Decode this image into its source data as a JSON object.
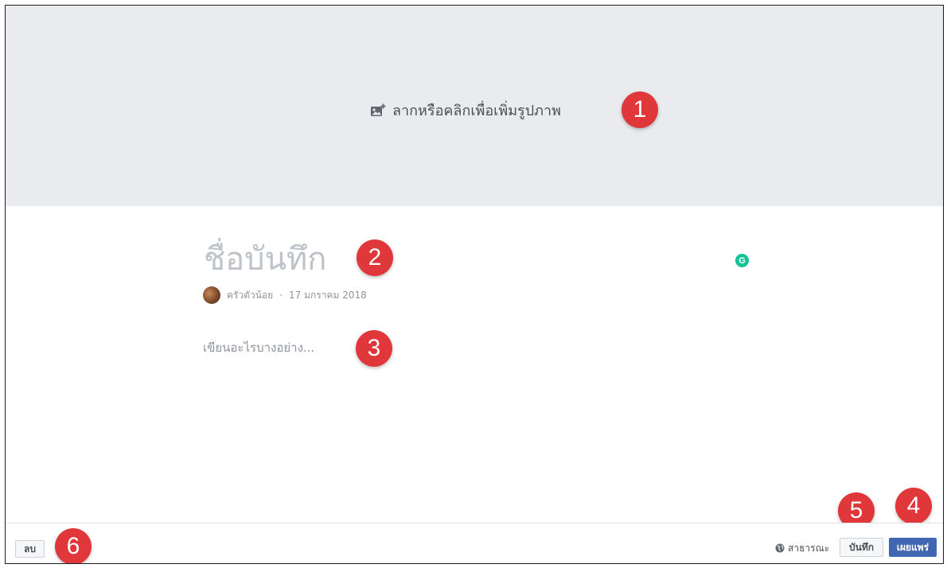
{
  "cover": {
    "prompt": "ลากหรือคลิกเพื่อเพิ่มรูปภาพ",
    "icon": "add-photo-icon"
  },
  "note": {
    "title_placeholder": "ชื่อบันทึก",
    "author": "ครัวตัวน้อย",
    "separator": "·",
    "date": "17 มกราคม 2018",
    "body_placeholder": "เขียนอะไรบางอย่าง..."
  },
  "footer": {
    "delete_label": "ลบ",
    "privacy_label": "สาธารณะ",
    "privacy_icon": "globe-icon",
    "save_label": "บันทึก",
    "publish_label": "เผยแพร่"
  },
  "grammarly": {
    "label": "G",
    "color": "#15c39a"
  },
  "annotations": [
    "1",
    "2",
    "3",
    "4",
    "5",
    "6"
  ],
  "colors": {
    "accent": "#4267b2",
    "badge": "#e0373a",
    "cover_bg": "#e9ebee"
  }
}
